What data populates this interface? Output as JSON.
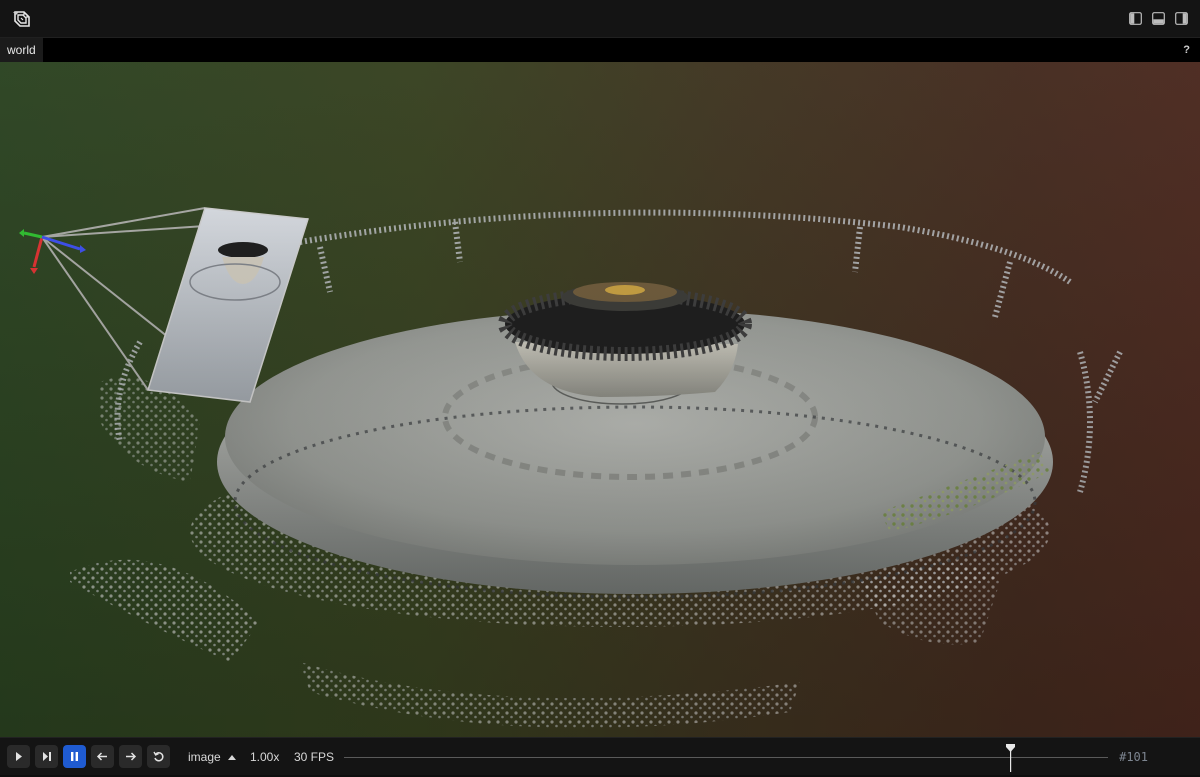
{
  "header": {
    "logo_icon": "rerun-logo-icon",
    "panel_toggles": [
      "left-panel-toggle-icon",
      "bottom-panel-toggle-icon",
      "right-panel-toggle-icon"
    ]
  },
  "tabs": {
    "active_label": "world",
    "help_label": "?"
  },
  "viewport": {
    "content": "3D point cloud of a circular fountain with camera frustum",
    "background_colors": [
      "#2a4220",
      "#4a281e"
    ],
    "axis_colors": {
      "x": "#e03030",
      "y": "#2ec02e",
      "z": "#3b4ef0"
    }
  },
  "timeline": {
    "buttons": [
      "play-icon",
      "step-end-icon",
      "pause-icon",
      "arrow-left-icon",
      "arrow-right-icon",
      "loop-icon"
    ],
    "active_button": "pause-icon",
    "timeline_name": "image",
    "speed": "1.00x",
    "fps": "30 FPS",
    "current_frame": "#101",
    "accent_color": "#1f5bd1"
  }
}
